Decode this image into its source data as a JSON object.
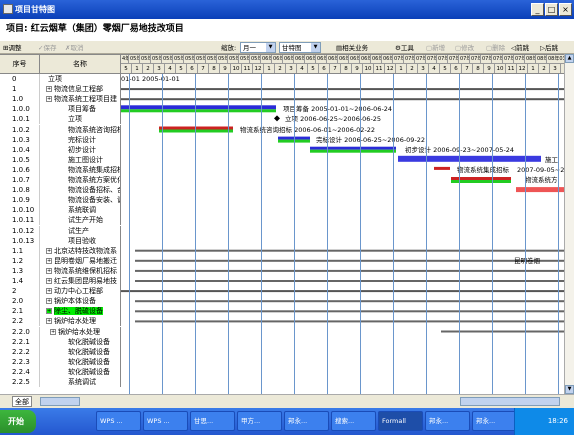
{
  "window": {
    "title": "项目甘特图",
    "buttons": [
      "_",
      "□",
      "×"
    ]
  },
  "project_title": "项目: 红云烟草（集团）零烟厂易地技改项目",
  "toolbar": {
    "adjust": "调整",
    "save": "保存",
    "cancel": "取消",
    "zoom_label": "缩放:",
    "zoom_value": "月一",
    "view_value": "甘特图",
    "related": "相关业务",
    "tools": "工具",
    "new": "新增",
    "edit": "修改",
    "delete": "删除",
    "prev": "前跳",
    "next": "后跳"
  },
  "columns": {
    "no": "序号",
    "name": "名称"
  },
  "months": [
    "4年12",
    "05年01月",
    "05年02月",
    "05年03月",
    "05年04月",
    "05年05月",
    "05年06月",
    "05年07月",
    "05年08月",
    "05年09月",
    "05年10月",
    "05年11月",
    "05年12月",
    "06年01月",
    "06年02月",
    "06年03月",
    "06年04月",
    "06年05月",
    "06年06月",
    "06年07月",
    "06年08月",
    "06年09月",
    "06年10月",
    "06年11月",
    "06年12月",
    "07年01月",
    "07年02月",
    "07年03月",
    "07年04月",
    "07年05月",
    "07年06月",
    "07年07月",
    "07年08月",
    "07年09月",
    "07年10月",
    "07年11月",
    "07年12月",
    "08年01月",
    "08年02月",
    "08年03"
  ],
  "weeks": [
    "5",
    "1",
    "2",
    "3",
    "4",
    "5",
    "6",
    "7",
    "8",
    "9",
    "10",
    "11",
    "12",
    "1",
    "2",
    "3",
    "4",
    "5",
    "6",
    "7",
    "8",
    "9",
    "10",
    "11",
    "12",
    "1",
    "2",
    "3",
    "4",
    "5",
    "6",
    "7",
    "8",
    "9",
    "10",
    "11",
    "12",
    "1",
    "2",
    "3",
    "4"
  ],
  "rows": [
    {
      "no": "0",
      "name": "立项"
    },
    {
      "no": "1",
      "name": "物流信息工程部",
      "plus": true
    },
    {
      "no": "1.0",
      "name": "物流系统工程项目建",
      "plus": true
    },
    {
      "no": "1.0.0",
      "name": "项目筹备"
    },
    {
      "no": "1.0.1",
      "name": "立项"
    },
    {
      "no": "1.0.2",
      "name": "物流系统咨询招标"
    },
    {
      "no": "1.0.3",
      "name": "完标设计"
    },
    {
      "no": "1.0.4",
      "name": "初步设计"
    },
    {
      "no": "1.0.5",
      "name": "施工图设计"
    },
    {
      "no": "1.0.6",
      "name": "物流系统集成招标"
    },
    {
      "no": "1.0.7",
      "name": "物流系统方案优化"
    },
    {
      "no": "1.0.8",
      "name": "物流设备招标、合"
    },
    {
      "no": "1.0.9",
      "name": "物流设备安装、调"
    },
    {
      "no": "1.0.10",
      "name": "系统联调"
    },
    {
      "no": "1.0.11",
      "name": "试生产开始"
    },
    {
      "no": "1.0.12",
      "name": "试生产"
    },
    {
      "no": "1.0.13",
      "name": "项目验收"
    },
    {
      "no": "1.1",
      "name": "北京达特技改物流系",
      "plus": true
    },
    {
      "no": "1.2",
      "name": "昆明卷烟厂易地搬迁",
      "plus": true
    },
    {
      "no": "1.3",
      "name": "物流系统维保机招标",
      "plus": true
    },
    {
      "no": "1.4",
      "name": "红云集团昆明易地技",
      "plus": true
    },
    {
      "no": "2",
      "name": "动力中心工程部",
      "plus": true
    },
    {
      "no": "2.0",
      "name": "锅炉本体设备",
      "plus": true
    },
    {
      "no": "2.1",
      "name": "除尘、脱硫设备",
      "plus": true,
      "hl": true
    },
    {
      "no": "2.2",
      "name": "锅炉给水处理",
      "plus": true
    },
    {
      "no": "2.2.0",
      "name": "锅炉给水处理",
      "plus": true
    },
    {
      "no": "2.2.1",
      "name": "软化脱碱设备"
    },
    {
      "no": "2.2.2",
      "name": "软化脱碱设备"
    },
    {
      "no": "2.2.3",
      "name": "软化脱碱设备"
    },
    {
      "no": "2.2.4",
      "name": "软化脱碱设备"
    },
    {
      "no": "2.2.5",
      "name": "系统调试"
    }
  ],
  "chart_labels": [
    {
      "text": "01-01 2005-01-01",
      "row": 0
    },
    {
      "text": "项目筹备  2005-01-01~2006-06-24",
      "row": 3
    },
    {
      "text": "立项  2006-06-25~2006-06-25",
      "row": 4
    },
    {
      "text": "物流系统咨询招标  2006-06-01~2006-02-22",
      "row": 5
    },
    {
      "text": "完标设计  2006-06-25~2006-09-22",
      "row": 6
    },
    {
      "text": "初步设计  2006-09-23~2007-05-24",
      "row": 7
    },
    {
      "text": "施工",
      "row": 8
    },
    {
      "text": "物流系统集成招标",
      "row": 9
    },
    {
      "text": "2007-09-05~2007",
      "row": 9
    },
    {
      "text": "物流系统方",
      "row": 10
    },
    {
      "text": "昆明卷烟",
      "row": 18
    }
  ],
  "bottom_tabs": [
    "全部"
  ],
  "taskbar": {
    "start": "开始",
    "items": [
      "WPS ...",
      "WPS ...",
      "甘思...",
      "甲方...",
      "邦永...",
      "搜索...",
      "Formall",
      "邦永...",
      "邦永...",
      "与大..."
    ],
    "clock": "18:26"
  }
}
